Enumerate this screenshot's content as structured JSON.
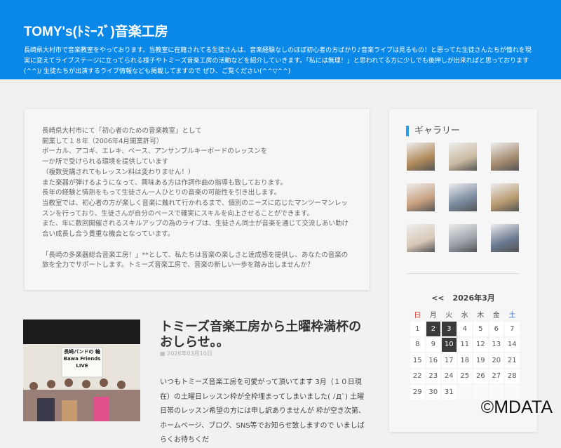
{
  "header": {
    "title": "TOMY's(ﾄﾐｰｽﾞ)音楽工房",
    "description": "長崎県大村市で音楽教室をやっております。当教室に在籍されてる生徒さんは、音楽経験なしのほぼ初心者の方ばかり♪音楽ライブは見るもの！と思ってた生徒さんたちが憧れを現実に変えてライブステージに立ってられる様子やトミーズ音楽工房の活動などを紹介していきます。「私には無理！」と思われてる方に少しでも後押しが出来ればと思っております(^^)/ 生徒たちが出演するライブ情報なども掲載してますので ぜひ、ご覧ください(^^▽^^)"
  },
  "intro": {
    "paragraph1": "長崎県大村市にて「初心者のための音楽教室」として\n開業して１８年（2006年4月開業許可）\nボーカル、アコギ、エレキ、ベース、アンサンブルキーボードのレッスンを\n一か所で受けられる環境を提供しています\n（複数受講されてもレッスン料は変わりません！）\nまた楽器が弾けるようになって、興味ある方は作詞作曲の指導も致しております。\n長年の経験と情熱をもって生徒さん一人ひとりの音楽の可能性を引き出します。\n当教室では、初心者の方が楽しく音楽に触れて行かれるまで、個別のニーズに応じたマンツーマンレッスンを行っており、生徒さんが自分のペースで確実にスキルを向上させることができます。\nまた、年に数回開催されるスキルアップの為のライブは、生徒さん同士が音楽を通じて交流しあい助け合い成長し合う貴重な機会となっています。",
    "paragraph2": "「長崎の多楽器総合音楽工房！」**として、私たちは音楽の楽しさと達成感を提供し、あなたの音楽の旅を全力でサポートします。トミーズ音楽工房で、音楽の新しい一歩を踏み出しませんか？"
  },
  "sidebar": {
    "gallery_title": "ギャラリー",
    "gallery_colors": [
      "#b08a5a",
      "#c9b9a0",
      "#a58c70",
      "#c8a080",
      "#7a8aa0",
      "#b89a70",
      "#d8c8b8",
      "#9aa0a8",
      "#6a7890"
    ],
    "calendar": {
      "prev": "<<",
      "month": "2026年3月",
      "weekdays": [
        "日",
        "月",
        "火",
        "水",
        "木",
        "金",
        "土"
      ],
      "weeks": [
        [
          "1",
          "2",
          "3",
          "4",
          "5",
          "6",
          "7"
        ],
        [
          "8",
          "9",
          "10",
          "11",
          "12",
          "13",
          "14"
        ],
        [
          "15",
          "16",
          "17",
          "18",
          "19",
          "20",
          "21"
        ],
        [
          "22",
          "23",
          "24",
          "25",
          "26",
          "27",
          "28"
        ],
        [
          "29",
          "30",
          "31",
          "",
          "",
          "",
          ""
        ]
      ],
      "highlighted": [
        "2",
        "3",
        "10"
      ]
    }
  },
  "post": {
    "title": "トミーズ音楽工房から土曜枠満杯のおしらせ。。",
    "date": "2026年03月10日",
    "image_banner": "長崎バンドの 輪 Bawa Friends LIVE",
    "excerpt": "いつもトミーズ音楽工房を可愛がって頂いてます 3月（１０日現在）の土曜日レッスン枠が全枠埋まってしまいました( ﾉД`) 土曜日帯のレッスン希望の方には申し訳ありませんが 枠が空き次第、ホームページ、ブログ、SNS等でお知らせ致しますので いましばらくお待ちくだ"
  },
  "watermark": "©MDATA"
}
